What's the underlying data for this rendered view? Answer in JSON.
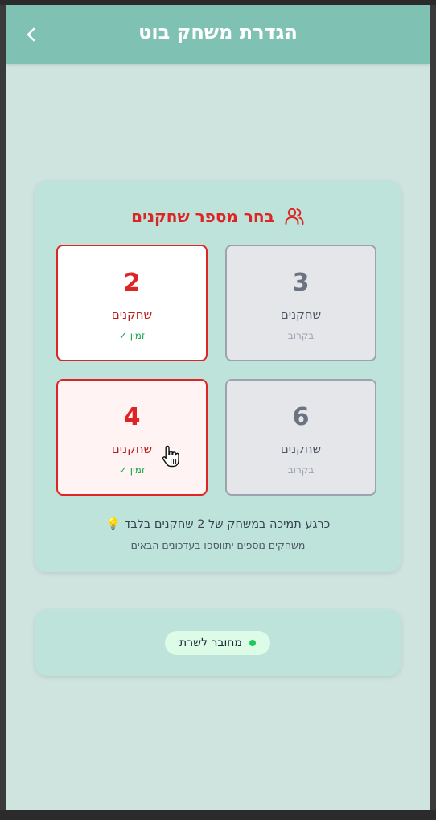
{
  "header": {
    "title": "הגדרת משחק בוט",
    "back_icon": "chevron-left-icon"
  },
  "player_select": {
    "title": "בחר מספר שחקנים",
    "title_icon": "users-icon",
    "options": [
      {
        "count": "2",
        "label": "שחקנים",
        "status": "זמין ✓",
        "available": true
      },
      {
        "count": "3",
        "label": "שחקנים",
        "status": "בקרוב",
        "available": false
      },
      {
        "count": "4",
        "label": "שחקנים",
        "status": "זמין ✓",
        "available": true
      },
      {
        "count": "6",
        "label": "שחקנים",
        "status": "בקרוב",
        "available": false
      }
    ],
    "note": "כרגע תמיכה במשחק של 2 שחקנים בלבד",
    "note_icon": "lightbulb-icon",
    "subnote": "משחקים נוספים יתווספו בעדכונים הבאים"
  },
  "connection": {
    "status": "מחובר לשרת",
    "status_color": "#22c55e"
  },
  "colors": {
    "accent": "#dc2626",
    "header_bg": "#7fc2b3",
    "page_bg": "#d0e4df",
    "card_bg": "#bde3da"
  }
}
